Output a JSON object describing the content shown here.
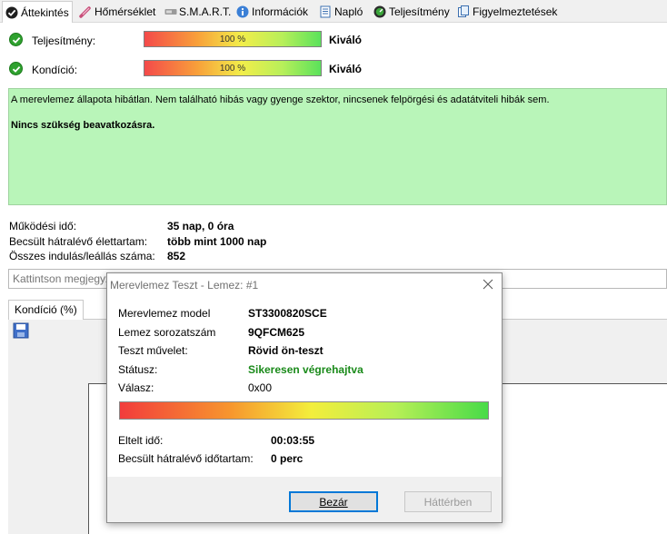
{
  "tabs": [
    {
      "label": "Áttekintés",
      "icon": "check-circle-icon",
      "active": true
    },
    {
      "label": "Hőmérséklet",
      "icon": "thermometer-icon",
      "active": false
    },
    {
      "label": "S.M.A.R.T.",
      "icon": "smart-drive-icon",
      "active": false
    },
    {
      "label": "Információk",
      "icon": "info-icon",
      "active": false
    },
    {
      "label": "Napló",
      "icon": "log-document-icon",
      "active": false
    },
    {
      "label": "Teljesítmény",
      "icon": "performance-gauge-icon",
      "active": false
    },
    {
      "label": "Figyelmeztetések",
      "icon": "warnings-document-icon",
      "active": false
    }
  ],
  "status": {
    "performance": {
      "label": "Teljesítmény:",
      "value": "100 %",
      "level": 1.0,
      "rating": "Kiváló"
    },
    "health": {
      "label": "Kondíció:",
      "value": "100 %",
      "level": 1.0,
      "rating": "Kiváló"
    }
  },
  "summary": {
    "text": "A merevlemez állapota hibátlan. Nem található hibás vagy gyenge szektor, nincsenek felpörgési és adatátviteli hibák sem.",
    "action": "Nincs szükség beavatkozásra."
  },
  "info": {
    "uptime_label": "Működési idő:",
    "uptime_value": "35 nap, 0 óra",
    "remaining_label": "Becsült hátralévő élettartam:",
    "remaining_value": "több mint 1000 nap",
    "starts_label": "Összes indulás/leállás száma:",
    "starts_value": "852"
  },
  "comment": {
    "placeholder": "Kattintson megjegyz"
  },
  "lower_tab": {
    "label": "Kondíció  (%)"
  },
  "dialog": {
    "title": "Merevlemez Teszt - Lemez: #1",
    "model_label": "Merevlemez model",
    "model_value": "ST3300820SCE",
    "serial_label": "Lemez sorozatszám",
    "serial_value": "9QFCM625",
    "operation_label": "Teszt művelet:",
    "operation_value": "Rövid ön-teszt",
    "status_label": "Státusz:",
    "status_value": "Sikeresen végrehajtva",
    "response_label": "Válasz:",
    "response_value": "0x00",
    "progress": 1.0,
    "elapsed_label": "Eltelt idő:",
    "elapsed_value": "00:03:55",
    "remaining_label": "Becsült hátralévő időtartam:",
    "remaining_value": "0 perc",
    "close_button": "Bezár",
    "background_button": "Háttérben"
  },
  "colors": {
    "ok_green": "#2fa12f",
    "summary_bg": "#b9f5b9",
    "status_success": "#1a8a1a",
    "focus_border": "#0078d7"
  }
}
